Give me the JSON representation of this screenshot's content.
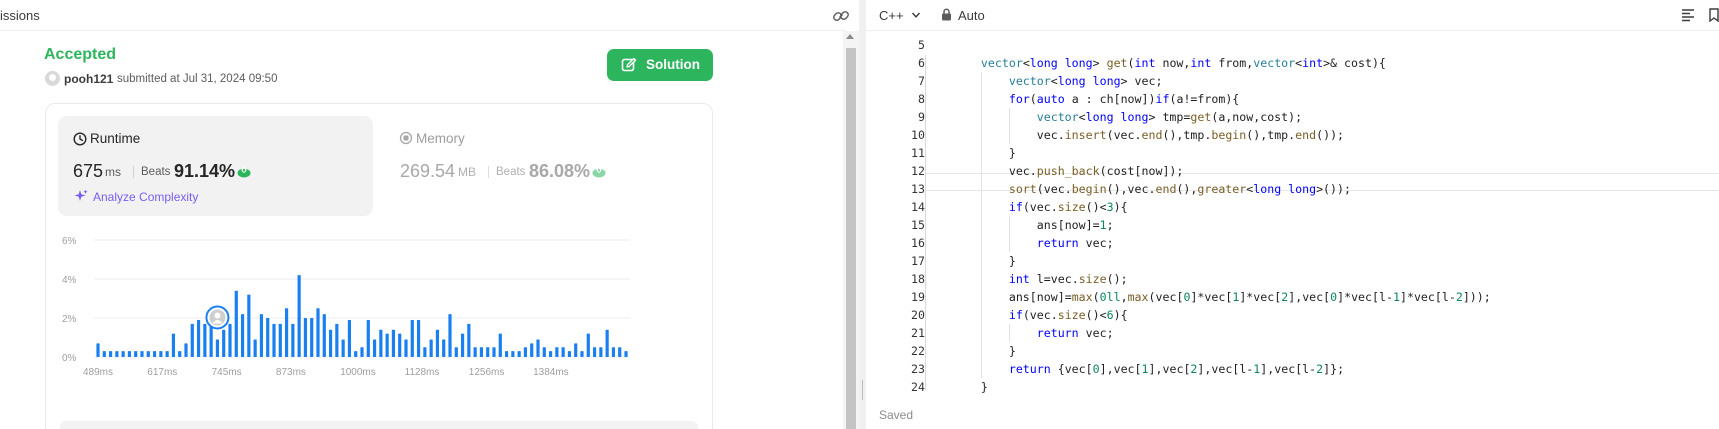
{
  "left_panel": {
    "header_title": "issions",
    "status": "Accepted",
    "username": "pooh121",
    "submitted_text": "submitted at Jul 31, 2024 09:50",
    "solution_button": "Solution",
    "runtime": {
      "label": "Runtime",
      "value": "675",
      "unit": "ms",
      "beats_label": "Beats",
      "beats_pct": "91.14%"
    },
    "analyze_label": "Analyze Complexity",
    "memory": {
      "label": "Memory",
      "value": "269.54",
      "unit": "MB",
      "beats_label": "Beats",
      "beats_pct": "86.08%"
    },
    "colors": {
      "accent": "#2db55d",
      "bar": "#1a7ff0",
      "analyze": "#7c5cf0"
    }
  },
  "chart_data": {
    "type": "bar",
    "ylim": [
      0,
      6
    ],
    "yticks": [
      "6%",
      "4%",
      "2%",
      "0%"
    ],
    "xticks": [
      "489ms",
      "617ms",
      "745ms",
      "873ms",
      "1000ms",
      "1128ms",
      "1256ms",
      "1384ms"
    ],
    "grid": true,
    "highlight_index": 19,
    "values": [
      0.7,
      0.3,
      0.3,
      0.3,
      0.3,
      0.3,
      0.3,
      0.3,
      0.3,
      0.3,
      0.3,
      0.3,
      1.2,
      0.3,
      0.7,
      1.7,
      1.9,
      1.7,
      2.2,
      0.9,
      1.4,
      1.7,
      3.4,
      2.2,
      3.2,
      0.9,
      2.2,
      2.0,
      1.7,
      1.7,
      2.5,
      1.7,
      4.2,
      2.0,
      2.0,
      2.5,
      2.2,
      1.4,
      1.7,
      0.9,
      1.9,
      0.3,
      0.5,
      1.9,
      0.9,
      1.4,
      1.2,
      1.4,
      1.2,
      0.9,
      1.9,
      1.9,
      0.5,
      0.9,
      1.4,
      0.9,
      2.2,
      0.5,
      1.2,
      1.7,
      0.5,
      0.5,
      0.5,
      0.5,
      1.2,
      0.3,
      0.3,
      0.3,
      0.5,
      0.7,
      0.9,
      0.5,
      0.3,
      0.5,
      0.5,
      0.3,
      0.7,
      0.3,
      1.2,
      0.5,
      0.5,
      1.4,
      0.5,
      0.5,
      0.3
    ]
  },
  "editor": {
    "language": "C++",
    "mode": "Auto",
    "saved": "Saved",
    "line_numbers": [
      "5",
      "6",
      "7",
      "8",
      "9",
      "10",
      "11",
      "12",
      "13",
      "14",
      "15",
      "16",
      "17",
      "18",
      "19",
      "20",
      "21",
      "22",
      "23",
      "24"
    ],
    "lines": [
      "",
      "    vector<long long> get(int now,int from,vector<int>& cost){",
      "        vector<long long> vec;",
      "        for(auto a : ch[now])if(a!=from){",
      "            vector<long long> tmp=get(a,now,cost);",
      "            vec.insert(vec.end(),tmp.begin(),tmp.end());",
      "        }",
      "        vec.push_back(cost[now]);",
      "        sort(vec.begin(),vec.end(),greater<long long>());",
      "        if(vec.size()<3){",
      "            ans[now]=1;",
      "            return vec;",
      "        }",
      "        int l=vec.size();",
      "        ans[now]=max(0ll,max(vec[0]*vec[1]*vec[2],vec[0]*vec[l-1]*vec[l-2]));",
      "        if(vec.size()<6){",
      "            return vec;",
      "        }",
      "        return {vec[0],vec[1],vec[2],vec[l-1],vec[l-2]};",
      "    }"
    ]
  }
}
